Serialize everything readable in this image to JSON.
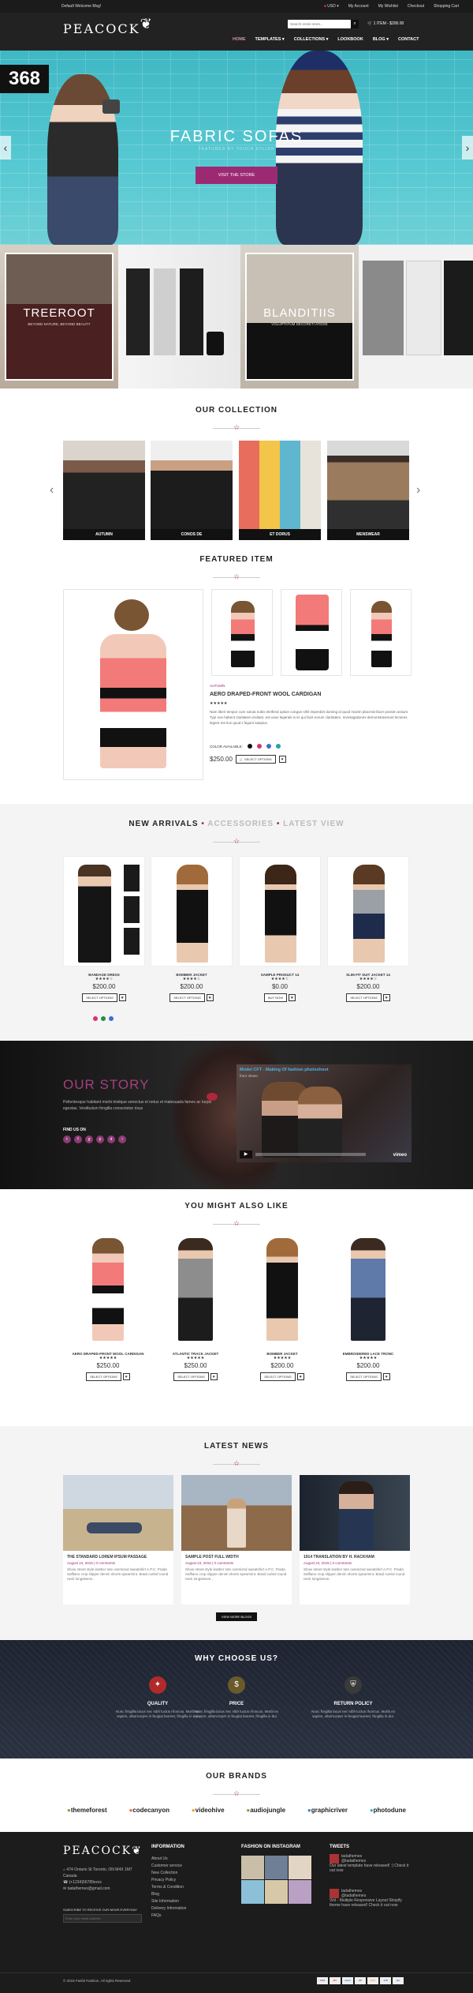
{
  "topbar": {
    "welcome": "Default Welcome Msg!",
    "currency": "USD",
    "links": [
      "My Account",
      "My Wishlist",
      "Checkout",
      "Shopping Cart"
    ]
  },
  "header": {
    "logo": "PEACOCK",
    "search_placeholder": "Search entire store...",
    "cart": "1 ITEM - $200.00",
    "nav": [
      "HOME",
      "TEMPLATES",
      "COLLECTIONS",
      "LOOKBOOK",
      "BLOG",
      "CONTACT"
    ]
  },
  "hero": {
    "badge": "368",
    "title": "FABRIC SOFAS",
    "subtitle": "FEATURED BY TOUCH SYLISH",
    "button": "VISIT THE STORE"
  },
  "promo": [
    {
      "title": "TREEROOT",
      "sub": "BEYOND NATURE, BEYOND BEAUTY"
    },
    {
      "title": "BLANDITIIS",
      "sub": "VOLUPTATUM DECORETI ATIDSE"
    }
  ],
  "collection": {
    "title": "OUR COLLECTION",
    "items": [
      "AUTUMN",
      "CONOS DE",
      "ET DORUS",
      "MENSWEAR"
    ]
  },
  "featured": {
    "title": "FEATURED ITEM",
    "category": "AUTUMN",
    "name": "AERO DRAPED-FRONT WOOL CARDIGAN",
    "rating": "★★★★★",
    "description": "Nam liberi tempor cum soluta nobis eleifend option congue nihil imperdiet doming id quod mazim placerat facer possim assum. Typi non habent claritatem insitam; est usus legentis in iis qui facit eorum claritatem. Investigationes demonstraverunt lectores legere me lius quod ii legunt saepius.",
    "color_label": "COLOR AVAILABLE:",
    "price": "$250.00",
    "button": "SELECT OPTIONS",
    "swatches": [
      "#111111",
      "#d8336a",
      "#3a6fd1",
      "#2aa0a6"
    ]
  },
  "arrivals": {
    "tabs": [
      "NEW ARRIVALS",
      "ACCESSORIES",
      "LATEST VIEW"
    ],
    "products": [
      {
        "name": "BANDAGE DRESS",
        "stars": "★★★★☆",
        "price": "$200.00",
        "button": "SELECT OPTIONS"
      },
      {
        "name": "BOMBER JACKET",
        "stars": "★★★★☆",
        "price": "$200.00",
        "button": "SELECT OPTIONS"
      },
      {
        "name": "SAMPLE PRODUCT 14",
        "stars": "★★★★☆",
        "price": "$0.00",
        "button": "BUY NOW"
      },
      {
        "name": "SLIM FIT SUIT JACKET 14",
        "stars": "★★★★☆",
        "price": "$200.00",
        "button": "SELECT OPTIONS"
      }
    ],
    "dots": [
      "#d8336a",
      "#2b8c3f",
      "#3a6fd1"
    ]
  },
  "story": {
    "title": "OUR STORY",
    "text": "Pellentesque habitant morbi tristique senectus et netus et malesuada fames ac turpis egestas. Vestibulum fringilla consectetur risus",
    "find_us": "FIND US ON",
    "video_title": "Model CFT - Making Of fashion photoshoot",
    "video_from": "from Vimeo",
    "video_brand": "vimeo"
  },
  "also_like": {
    "title": "YOU MIGHT ALSO LIKE",
    "products": [
      {
        "name": "AERO DRAPED-FRONT WOOL CARDIGAN",
        "stars": "★★★★★",
        "price": "$250.00",
        "button": "SELECT OPTIONS"
      },
      {
        "name": "ATLANTIC TRACK JACKET",
        "stars": "★★★★★",
        "price": "$250.00",
        "button": "SELECT OPTIONS"
      },
      {
        "name": "BOMBER JACKET",
        "stars": "★★★★★",
        "price": "$200.00",
        "button": "SELECT OPTIONS"
      },
      {
        "name": "EMBROIDERED LACE TRONC",
        "stars": "★★★★★",
        "price": "$200.00",
        "button": "SELECT OPTIONS"
      }
    ]
  },
  "news": {
    "title": "LATEST NEWS",
    "button": "VIEW MORE BLOGS",
    "posts": [
      {
        "title": "THE STANDARD LOREM IPSUM PASSAGE",
        "meta": "August 24, 2015  |  0 comments",
        "excerpt": "Show street style leather tote oversized sweatshirt A.P.C. Prada Saffiano crop slipper denim shorts spearmint. Braid curled round neck longsleeve.."
      },
      {
        "title": "SAMPLE POST FULL WIDTH",
        "meta": "August 24, 2015  |  0 comments",
        "excerpt": "Show street style leather tote oversized sweatshirt A.P.C. Prada Saffiano crop slipper denim shorts spearmint. Braid curled round neck longsleeve.."
      },
      {
        "title": "1914 TRANSLATION BY H. RACKHAM",
        "meta": "August 24, 2015  |  0 comments",
        "excerpt": "Show street style leather tote oversized sweatshirt A.P.C. Prada Saffiano crop slipper denim shorts spearmint. Braid curled round neck longsleeve.."
      }
    ]
  },
  "why": {
    "title": "WHY CHOOSE US?",
    "items": [
      {
        "icon": "gift-icon",
        "glyph": "✦",
        "title": "QUALITY",
        "text": "Nunc fringilla lacus nec nibh luctus rhoncus. Morbi ex sapien, ullamcorper in feugiat laoreet, fringilla in dui."
      },
      {
        "icon": "dollar-icon",
        "glyph": "$",
        "title": "PRICE",
        "text": "Nunc fringilla lacus nec nibh luctus rhoncus. Morbi ex sapien, ullamcorper in feugiat laoreet, fringilla in dui."
      },
      {
        "icon": "shield-icon",
        "glyph": "⛨",
        "title": "RETURN POLICY",
        "text": "Nunc fringilla lacus nec nibh luctus rhoncus. Morbi ex sapien, ullamcorper in feugiat laoreet, fringilla in dui."
      }
    ]
  },
  "brands": {
    "title": "OUR BRANDS",
    "items": [
      "themeforest",
      "codecanyon",
      "videohive",
      "audiojungle",
      "graphicriver",
      "photodune"
    ]
  },
  "footer": {
    "logo": "PEACOCK",
    "address": "474 Ontario St Toronto, ON M4X 1M7 Canada",
    "phone": "(+1234)56789xxxx",
    "email": "tadathemes@gmail.com",
    "newsletter_label": "SUBSCRIBE TO RECEIVE OUR NEWS EVERYDAY",
    "newsletter_placeholder": "Enter your email address",
    "info_title": "INFORMATION",
    "info_links": [
      "About Us",
      "Customer service",
      "New Collection",
      "Privacy Policy",
      "Terms & Condition",
      "Blog",
      "Site Information",
      "Delivery Information",
      "FAQs"
    ],
    "instagram_title": "FASHION ON INSTAGRAM",
    "tweets_title": "TWEETS",
    "tweets": [
      {
        "user": "tadathemes",
        "handle": "@tadathemes",
        "text": "Our latest template have released! :) Check it out now"
      },
      {
        "user": "tadathemes",
        "handle": "@tadathemes",
        "text": "Vinl - Multiple Responsive Layout Shopify theme have released! Check it out now"
      }
    ],
    "copyright": "© 2015 Fasfol Fashion. All rights Reserved",
    "payments": [
      "VISA",
      "MC",
      "AMEX",
      "PP",
      "DISC",
      "JCB",
      "DC"
    ]
  }
}
